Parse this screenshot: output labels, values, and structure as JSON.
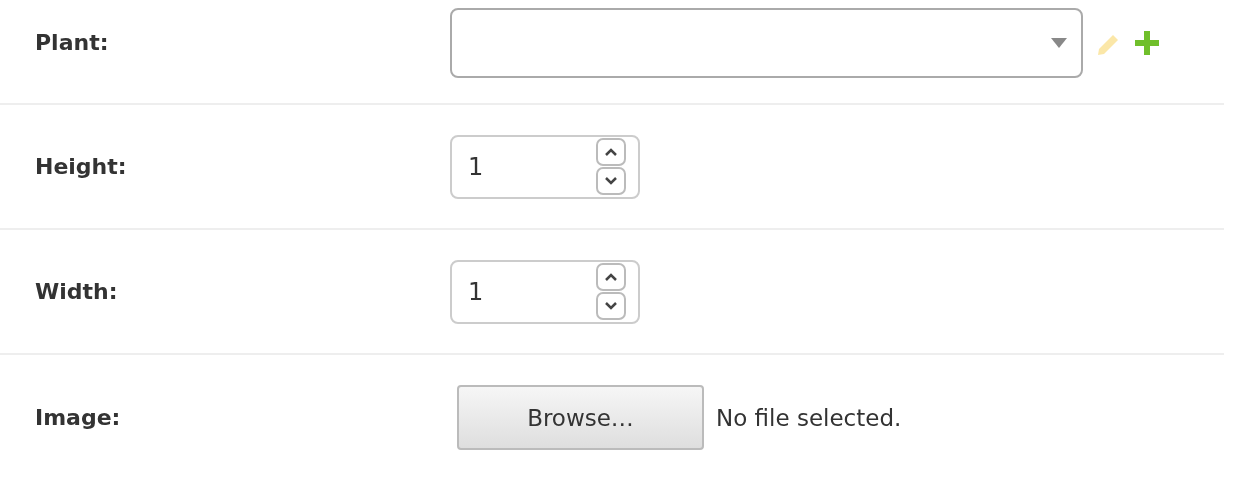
{
  "rows": [
    {
      "kind": "select",
      "label": "Plant:",
      "value": "",
      "edit_disabled": true
    },
    {
      "kind": "number",
      "label": "Height:",
      "value": "1"
    },
    {
      "kind": "number",
      "label": "Width:",
      "value": "1"
    },
    {
      "kind": "file",
      "label": "Image:",
      "button": "Browse…",
      "status": "No file selected."
    }
  ]
}
